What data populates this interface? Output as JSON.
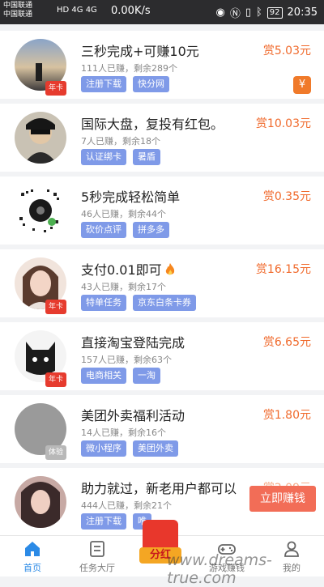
{
  "statusbar": {
    "carrier1": "中国联通",
    "carrier2": "中国联通",
    "network": "HD 4G 4G",
    "speed": "0.00K/s",
    "battery": "92",
    "time": "20:35"
  },
  "tasks": [
    {
      "title": "三秒完成+可赚10元",
      "stats": "111人已赚，剩余289个",
      "tags": [
        "注册下载",
        "快分网"
      ],
      "reward": "赏5.03元",
      "badge": "年卡",
      "extra_badge": "¥"
    },
    {
      "title": "国际大盘，复投有红包。",
      "stats": "7人已赚，剩余18个",
      "tags": [
        "认证绑卡",
        "暑盾"
      ],
      "reward": "赏10.03元"
    },
    {
      "title": "5秒完成轻松简单",
      "stats": "46人已赚，剩余44个",
      "tags": [
        "砍价点评",
        "拼多多"
      ],
      "reward": "赏0.35元"
    },
    {
      "title": "支付0.01即可",
      "stats": "43人已赚，剩余17个",
      "tags": [
        "特单任务",
        "京东白条卡券"
      ],
      "reward": "赏16.15元",
      "badge": "年卡"
    },
    {
      "title": "直接淘宝登陆完成",
      "stats": "157人已赚，剩余63个",
      "tags": [
        "电商相关",
        "一淘"
      ],
      "reward": "赏6.65元",
      "badge": "年卡"
    },
    {
      "title": "美团外卖福利活动",
      "stats": "14人已赚，剩余16个",
      "tags": [
        "微小程序",
        "美团外卖"
      ],
      "reward": "赏1.80元",
      "badge": "体验"
    },
    {
      "title": "助力就过，新老用户都可以",
      "stats": "444人已赚，剩余21个",
      "tags": [
        "注册下载",
        "唯"
      ],
      "reward": "赏2.09元"
    }
  ],
  "float_button": "立即赚钱",
  "red_envelope_label": "分红",
  "nav": [
    "首页",
    "任务大厅",
    "",
    "游戏赚钱",
    "我的"
  ],
  "watermark": "www.dreams-true.com",
  "colors": {
    "accent": "#2b8ae6",
    "reward": "#f06a2c",
    "tag": "#7f9ae8"
  }
}
